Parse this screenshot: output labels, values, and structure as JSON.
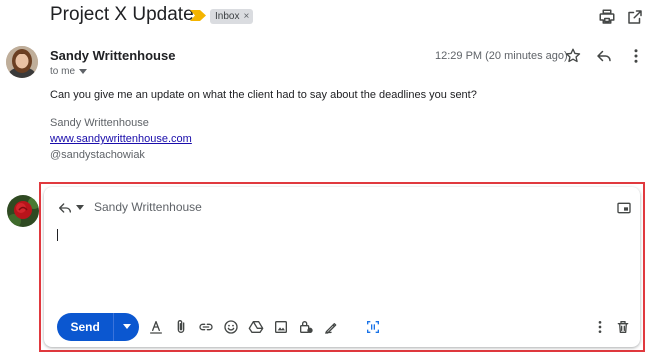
{
  "email": {
    "subject": "Project X Update",
    "label_chip": "Inbox",
    "label_chip_close": "×",
    "sender_name": "Sandy Writtenhouse",
    "recipient": "to me",
    "timestamp": "12:29 PM (20 minutes ago)",
    "body": "Can you give me an update on what the client had to say about the deadlines you sent?",
    "signature": {
      "name": "Sandy Writtenhouse",
      "website": "www.sandywrittenhouse.com",
      "handle": "@sandystachowiak"
    }
  },
  "reply": {
    "to": "Sandy Writtenhouse",
    "send_label": "Send"
  },
  "colors": {
    "send_button": "#0b57d0",
    "highlight_border": "#e0393e",
    "important_marker": "#f4b400",
    "link": "#1a0dab"
  },
  "icons": {
    "header": [
      "print-icon",
      "open-in-new-window-icon"
    ],
    "message": [
      "star-icon",
      "reply-icon",
      "more-vert-icon"
    ],
    "compose_top": [
      "reply-type-icon",
      "pop-out-icon"
    ],
    "toolbar": [
      "formatting-icon",
      "attach-icon",
      "link-icon",
      "emoji-icon",
      "drive-icon",
      "photo-icon",
      "confidential-icon",
      "signature-icon",
      "layouts-icon",
      "more-options-icon",
      "discard-icon"
    ]
  }
}
